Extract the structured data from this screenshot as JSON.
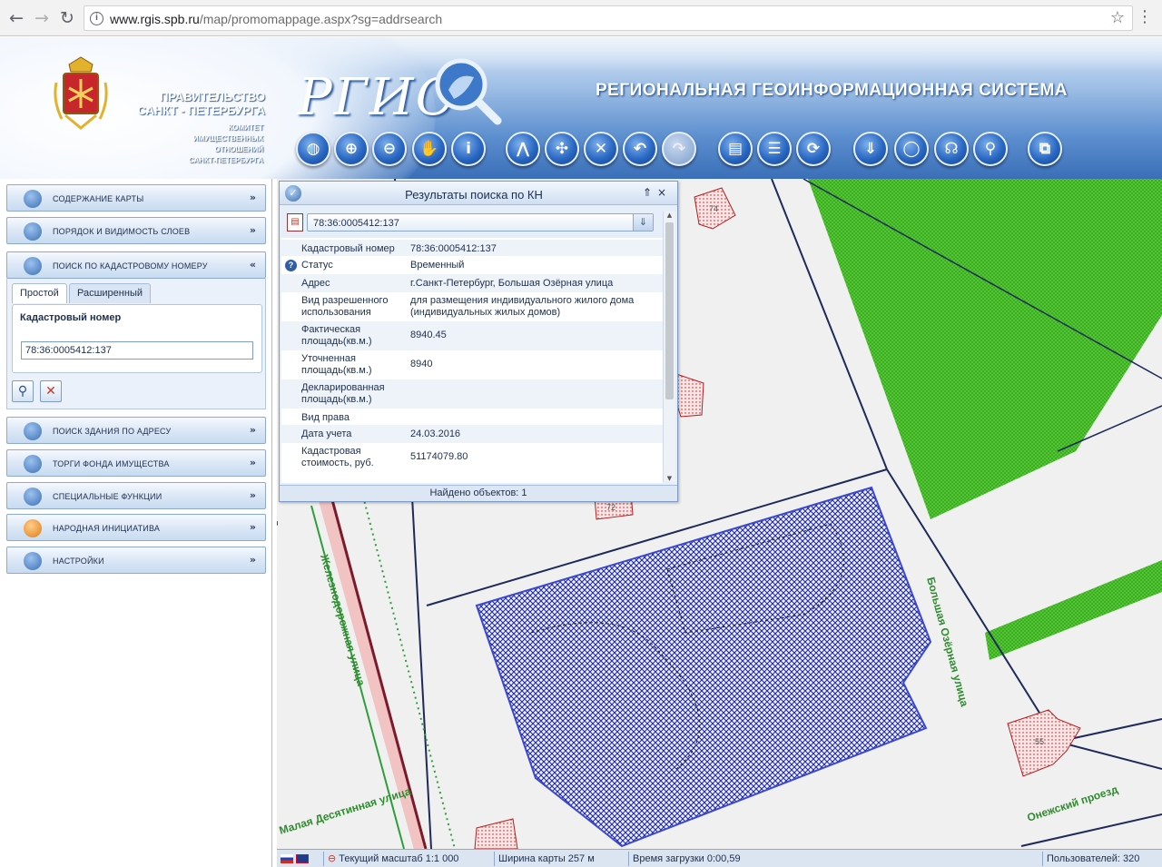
{
  "browser": {
    "url_domain": "www.rgis.spb.ru",
    "url_path": "/map/promomappage.aspx?sg=addrsearch"
  },
  "header": {
    "gov_line1": "ПРАВИТЕЛЬСТВО",
    "gov_line2": "САНКТ - ПЕТЕРБУРГА",
    "committee": [
      "КОМИТЕТ",
      "ИМУЩЕСТВЕННЫХ",
      "ОТНОШЕНИЙ",
      "САНКТ-ПЕТЕРБУРГА"
    ],
    "logo": "РГИС",
    "system_title": "РЕГИОНАЛЬНАЯ  ГЕОИНФОРМАЦИОННАЯ СИСТЕМА"
  },
  "toolbar": [
    {
      "name": "globe-icon",
      "glyph": "◍"
    },
    {
      "name": "zoom-in-icon",
      "glyph": "⊕"
    },
    {
      "name": "zoom-out-icon",
      "glyph": "⊖"
    },
    {
      "name": "pan-hand-icon",
      "glyph": "✋"
    },
    {
      "name": "info-icon",
      "glyph": "i"
    },
    {
      "name": "measure-icon",
      "glyph": "⋀"
    },
    {
      "name": "select-icon",
      "glyph": "✣"
    },
    {
      "name": "clear-icon",
      "glyph": "✕"
    },
    {
      "name": "undo-icon",
      "glyph": "↶"
    },
    {
      "name": "redo-icon",
      "glyph": "↷"
    },
    {
      "name": "print-icon",
      "glyph": "▤"
    },
    {
      "name": "list-icon",
      "glyph": "☰"
    },
    {
      "name": "refresh-globe-icon",
      "glyph": "⟳"
    },
    {
      "name": "download-icon",
      "glyph": "⇓"
    },
    {
      "name": "comment-icon",
      "glyph": "◯"
    },
    {
      "name": "rss-icon",
      "glyph": "☊"
    },
    {
      "name": "location-pin-icon",
      "glyph": "⚲"
    },
    {
      "name": "export-icon",
      "glyph": "⧉"
    }
  ],
  "sidebar": {
    "sections": [
      {
        "label": "СОДЕРЖАНИЕ КАРТЫ",
        "chevron": "»"
      },
      {
        "label": "ПОРЯДОК И ВИДИМОСТЬ СЛОЕВ",
        "chevron": "»"
      },
      {
        "label": "ПОИСК ПО КАДАСТРОВОМУ НОМЕРУ",
        "chevron": "«"
      },
      {
        "label": "ПОИСК ЗДАНИЯ ПО АДРЕСУ",
        "chevron": "»"
      },
      {
        "label": "ТОРГИ ФОНДА ИМУЩЕСТВА",
        "chevron": "»"
      },
      {
        "label": "СПЕЦИАЛЬНЫЕ ФУНКЦИИ",
        "chevron": "»"
      },
      {
        "label": "НАРОДНАЯ ИНИЦИАТИВА",
        "chevron": "»"
      },
      {
        "label": "НАСТРОЙКИ",
        "chevron": "»"
      }
    ],
    "cad_search": {
      "tabs": [
        "Простой",
        "Расширенный"
      ],
      "field_label": "Кадастровый номер",
      "field_value": "78:36:0005412:137"
    }
  },
  "dialog": {
    "title": "Результаты поиска по КН",
    "combo_value": "78:36:0005412:137",
    "rows": [
      {
        "key": "Кадастровый номер",
        "value": "78:36:0005412:137"
      },
      {
        "key": "Статус",
        "value": "Временный",
        "help": "?"
      },
      {
        "key": "Адрес",
        "value": "г.Санкт-Петербург, Большая Озёрная улица"
      },
      {
        "key": "Вид разрешенного использования",
        "value": "для размещения индивидуального жилого дома (индивидуальных жилых домов)"
      },
      {
        "key": "Фактическая площадь(кв.м.)",
        "value": "8940.45"
      },
      {
        "key": "Уточненная площадь(кв.м.)",
        "value": "8940"
      },
      {
        "key": "Декларированная площадь(кв.м.)",
        "value": ""
      },
      {
        "key": "Вид права",
        "value": ""
      },
      {
        "key": "Дата учета",
        "value": "24.03.2016"
      },
      {
        "key": "Кадастровая стоимость, руб.",
        "value": "51174079.80"
      }
    ],
    "footer": "Найдено объектов: 1"
  },
  "map": {
    "streets": [
      "Железнодорожная улица",
      "Большая Озёрная улица",
      "Малая Десятинная улица",
      "Онежский проезд"
    ],
    "house_numbers": [
      "74",
      "72",
      "55"
    ]
  },
  "status": {
    "scale": "Текущий масштаб 1:1 000",
    "width": "Ширина карты 257 м",
    "load_time": "Время загрузки 0:00,59",
    "users": "Пользователей: 320"
  },
  "colors": {
    "accent": "#2a68c3",
    "parcel": "#1f2aa6",
    "greenzone": "#2e9e1f"
  }
}
